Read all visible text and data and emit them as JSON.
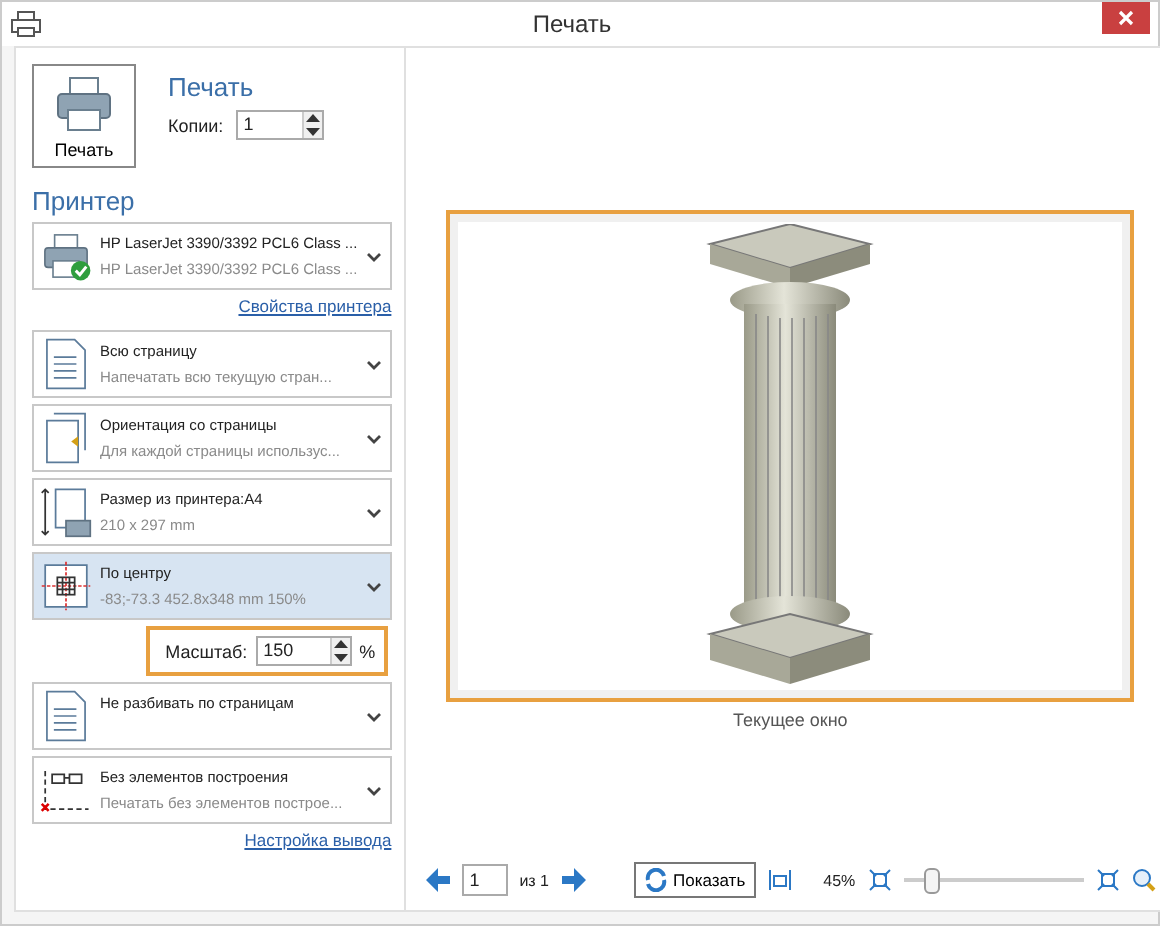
{
  "window": {
    "title": "Печать"
  },
  "print": {
    "button": "Печать",
    "heading": "Печать",
    "copies_label": "Копии:",
    "copies": "1"
  },
  "printer": {
    "heading": "Принтер",
    "name": "HP LaserJet 3390/3392 PCL6 Class ...",
    "detail": "HP LaserJet 3390/3392 PCL6 Class ...",
    "ready": true,
    "link": "Свойства принтера"
  },
  "settings": [
    {
      "kind": "page",
      "title": "Всю страницу",
      "subtitle": "Напечатать всю текущую стран...",
      "selected": false
    },
    {
      "kind": "orientation",
      "title": "Ориентация со страницы",
      "subtitle": "Для каждой страницы использус...",
      "selected": false
    },
    {
      "kind": "size",
      "title": "Размер из принтера:A4",
      "subtitle": "210 x 297 mm",
      "selected": false
    },
    {
      "kind": "center",
      "title": "По центру",
      "subtitle": "-83;-73.3  452.8x348 mm 150%",
      "selected": true
    },
    {
      "kind": "scale",
      "label": "Масштаб:",
      "value": "150",
      "unit": "%"
    },
    {
      "kind": "page",
      "title": "Не разбивать по страницам",
      "selected": false
    },
    {
      "kind": "elements",
      "title": "Без элементов построения",
      "subtitle": "Печатать без элементов построе...",
      "selected": false
    }
  ],
  "output_link": "Настройка вывода",
  "preview": {
    "caption": "Текущее окно"
  },
  "toolbar": {
    "page": "1",
    "of": "из 1",
    "show": "Показать",
    "zoom": "45%",
    "level": 0.16
  }
}
